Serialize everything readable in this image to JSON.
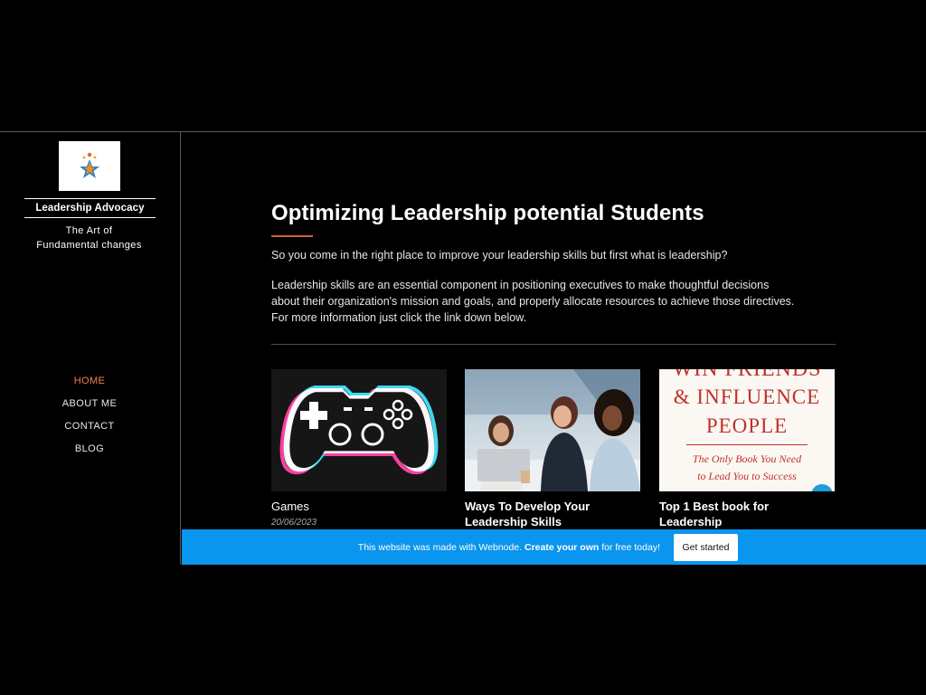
{
  "sidebar": {
    "brand_name": "Leadership Advocacy",
    "tagline_line1": "The Art of",
    "tagline_line2": "Fundamental changes",
    "nav": [
      {
        "label": "HOME",
        "active": true
      },
      {
        "label": "ABOUT ME",
        "active": false
      },
      {
        "label": "CONTACT",
        "active": false
      },
      {
        "label": "BLOG",
        "active": false
      }
    ]
  },
  "main": {
    "title": "Optimizing Leadership potential Students",
    "intro": "So you come in the right place to improve your leadership skills but first what is leadership?",
    "description": "Leadership skills are an essential component in positioning executives to make thoughtful decisions about their organization's mission and goals, and properly allocate resources to achieve those directives. For more information just click the link down below."
  },
  "cards": [
    {
      "title": "Games",
      "date": "20/06/2023"
    },
    {
      "title_line1": "Ways To Develop Your",
      "title_line2": "Leadership Skills"
    },
    {
      "title_line1": "Top 1 Best book for",
      "title_line2": "Leadership",
      "book_text_top": "WIN FRIENDS",
      "book_text_line1": "& INFLUENCE",
      "book_text_line2": "PEOPLE",
      "book_sub_line1": "The Only Book You Need",
      "book_sub_line2": "to Lead You to Success"
    }
  ],
  "banner": {
    "text_prefix": "This website was made with Webnode. ",
    "text_bold": "Create your own",
    "text_suffix": " for free today!",
    "button_label": "Get started"
  },
  "colors": {
    "background": "#000000",
    "accent": "#f07f4e",
    "banner": "#0a95ee",
    "gamepad_pink": "#ff3fa4",
    "gamepad_cyan": "#3fd9f0"
  }
}
